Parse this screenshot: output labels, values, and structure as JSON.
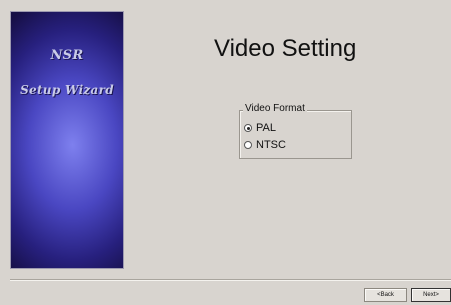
{
  "banner": {
    "line1": "NSR",
    "line2": "Setup Wizard"
  },
  "page": {
    "title": "Video Setting"
  },
  "video_format": {
    "legend": "Video Format",
    "options": [
      {
        "label": "PAL",
        "checked": true
      },
      {
        "label": "NTSC",
        "checked": false
      }
    ]
  },
  "buttons": {
    "back": "<Back",
    "next": "Next>"
  }
}
